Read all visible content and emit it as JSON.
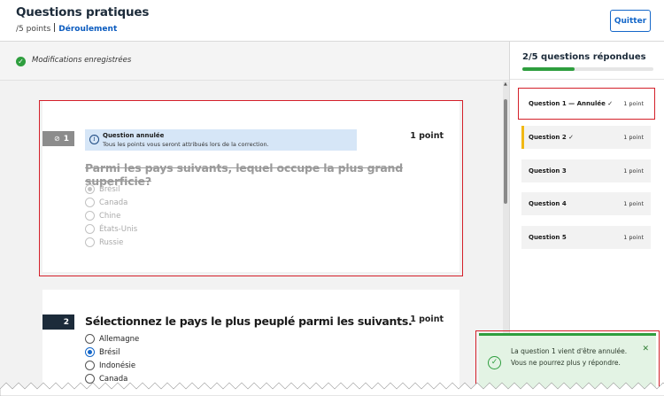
{
  "header": {
    "title": "Questions pratiques",
    "points": "/5 points",
    "link": "Déroulement",
    "quit_label": "Quitter"
  },
  "save_status": "Modifications enregistrées",
  "questions": [
    {
      "number": "1",
      "info_title": "Question annulée",
      "info_text": "Tous les points vous seront attribués lors de la correction.",
      "points": "1 point",
      "text": "Parmi les pays suivants, lequel occupe la plus grand superficie?",
      "options": [
        "Brésil",
        "Canada",
        "Chine",
        "États-Unis",
        "Russie"
      ],
      "selected": "Brésil"
    },
    {
      "number": "2",
      "points": "1 point",
      "text": "Sélectionnez le pays le plus peuplé parmi les suivants.",
      "options": [
        "Allemagne",
        "Brésil",
        "Indonésie",
        "Canada"
      ],
      "selected": "Brésil"
    }
  ],
  "panel": {
    "title": "2/5 questions répondues",
    "progress": 0.4,
    "items": [
      {
        "name": "Question 1",
        "suffix": "— Annulée",
        "check": "✓",
        "points": "1 point"
      },
      {
        "name": "Question 2",
        "suffix": "",
        "check": "✓",
        "points": "1 point"
      },
      {
        "name": "Question 3",
        "suffix": "",
        "check": "",
        "points": "1 point"
      },
      {
        "name": "Question 4",
        "suffix": "",
        "check": "",
        "points": "1 point"
      },
      {
        "name": "Question 5",
        "suffix": "",
        "check": "",
        "points": "1 point"
      }
    ]
  },
  "toast": {
    "message": "La question 1 vient d'être annulée. Vous ne pourrez plus y répondre."
  },
  "colors": {
    "accent": "#1467c9",
    "success": "#2e9e3e",
    "flag": "#f1b814",
    "highlight": "#d4202a"
  }
}
